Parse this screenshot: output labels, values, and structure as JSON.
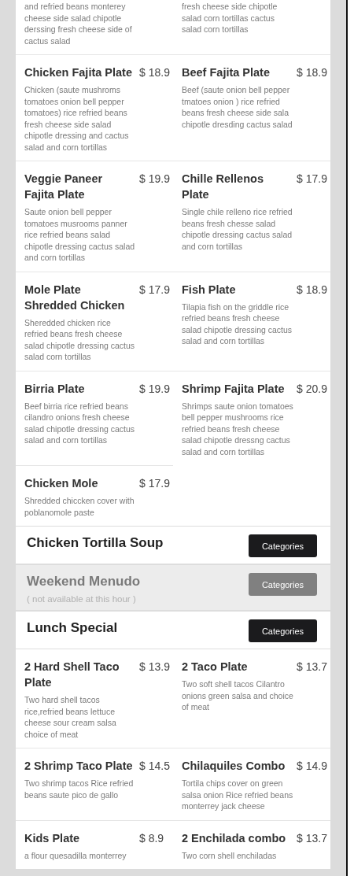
{
  "sections": [
    {
      "items": [
        {
          "description": "and refried beans monterey cheese side salad chipotle derssing fresh cheese side of cactus salad"
        },
        {
          "description": "fresh cheese side chipotle salad corn tortillas cactus salad corn tortillas"
        },
        {
          "name": "Chicken Fajita Plate",
          "price": "$ 18.9",
          "description": "Chicken (saute mushroms tomatoes onion bell pepper tomatoes) rice refried beans fresh cheese side salad chipotle dressing and cactus salad and corn tortillas"
        },
        {
          "name": "Beef Fajita Plate",
          "price": "$ 18.9",
          "description": "Beef (saute onion bell pepper tmatoes onion ) rice refried beans fresh cheese side sala chipotle dresding cactus salad"
        },
        {
          "name": "Veggie Paneer Fajita Plate",
          "price": "$ 19.9",
          "description": "Saute onion bell pepper tomatoes musrooms panner rice refried beans salad chipotle dressing cactus salad and corn tortillas"
        },
        {
          "name": "Chille Rellenos Plate",
          "price": "$ 17.9",
          "description": "Single chile relleno rice refried beans fresh chesse salad chipotle dressing cactus salad and corn tortillas"
        },
        {
          "name": "Mole Plate Shredded Chicken",
          "price": "$ 17.9",
          "description": "Sheredded chicken rice refried beans fresh cheese salad chipotle dressing cactus salad corn tortillas"
        },
        {
          "name": "Fish Plate",
          "price": "$ 18.9",
          "description": "Tilapia fish on the griddle rice refried beans fresh cheese salad chipotle dressing cactus salad and corn tortillas"
        },
        {
          "name": "Birria Plate",
          "price": "$ 19.9",
          "description": "Beef birria rice refried beans cilandro onions fresh cheese salad chipotle dressing cactus salad and corn tortillas"
        },
        {
          "name": "Shrimp Fajita Plate",
          "price": "$ 20.9",
          "description": "Shrimps saute onion tomatoes bell pepper mushrooms rice refried beans fresh cheese salad chipotle dressng cactus salad and corn tortillas"
        },
        {
          "name": "Chicken Mole",
          "price": "$ 17.9",
          "description": "Shredded chiccken cover with poblanomole paste"
        }
      ]
    },
    {
      "title": "Chicken Tortilla Soup",
      "available": true,
      "button": "Categories"
    },
    {
      "title": "Weekend Menudo",
      "available": false,
      "note": "( not available at this hour )",
      "button": "Categories"
    },
    {
      "title": "Lunch Special",
      "available": true,
      "button": "Categories",
      "items": [
        {
          "name": "2 Hard Shell Taco Plate",
          "price": "$ 13.9",
          "description": "Two hard shell tacos rice,refried beans lettuce cheese sour cream salsa choice of meat"
        },
        {
          "name": "2 Taco Plate",
          "price": "$ 13.7",
          "description": "Two soft shell tacos Cilantro onions green salsa and choice of meat"
        },
        {
          "name": "2 Shrimp Taco Plate",
          "price": "$ 14.5",
          "description": "Two shrimp tacos Rice refried beans saute pico de gallo"
        },
        {
          "name": "Chilaquiles Combo",
          "price": "$ 14.9",
          "description": "Tortila chips cover on green salsa onion Rice refried beans monterrey jack cheese"
        },
        {
          "name": "Kids Plate",
          "price": "$ 8.9",
          "description": "a flour quesadilla monterrey"
        },
        {
          "name": "2 Enchilada combo",
          "price": "$ 13.7",
          "description": "Two corn shell enchiladas"
        }
      ]
    }
  ]
}
